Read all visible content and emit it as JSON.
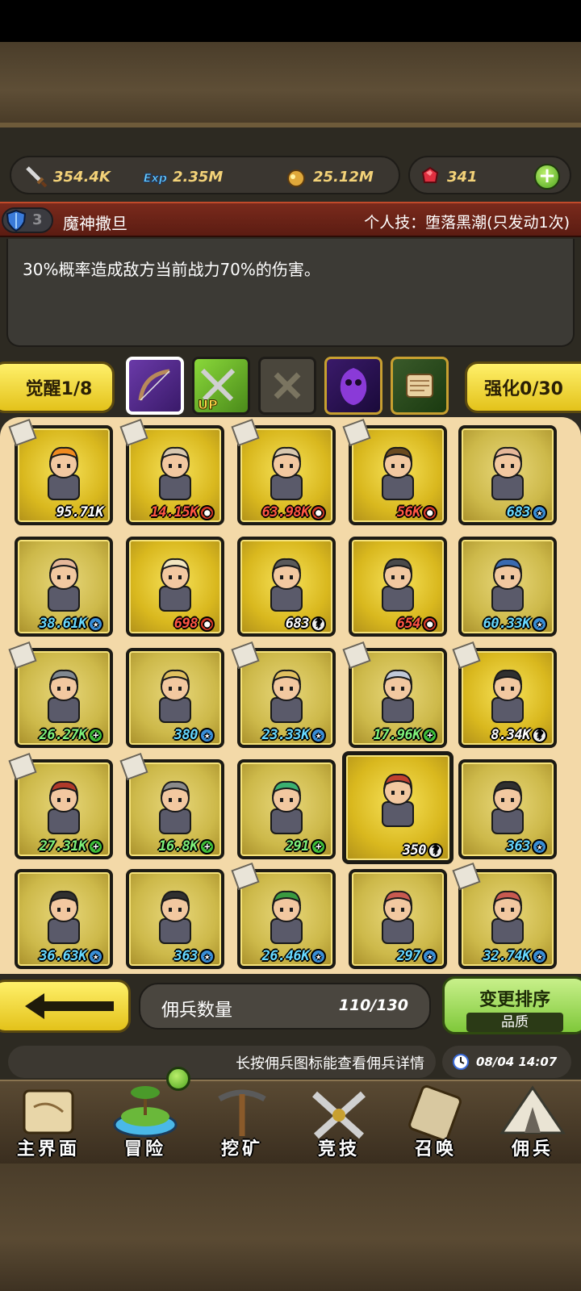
{
  "resources": {
    "attack": "354.4K",
    "exp": "2.35M",
    "gold": "25.12M",
    "gems": "341"
  },
  "skill": {
    "level": "3",
    "name": "魔神撒旦",
    "type": "个人技：堕落黑潮(只发动1次)",
    "description": "30%概率造成敌方当前战力70%的伤害。"
  },
  "tabs": {
    "awaken": "觉醒1/8",
    "enhance": "强化0/30",
    "icons": [
      "bow-icon",
      "upgrade-up-icon",
      "empty-slot-icon",
      "dark-spirit-icon",
      "scroll-icon"
    ],
    "up_label": "UP"
  },
  "mercenaries": [
    {
      "power": "95.71K",
      "color": "white",
      "badge": "",
      "note": true,
      "hair": "#f08a20"
    },
    {
      "power": "14.15K",
      "color": "red",
      "badge": "red",
      "note": true,
      "hair": "#d8c8b0"
    },
    {
      "power": "63.98K",
      "color": "red",
      "badge": "red",
      "note": true,
      "hair": "#d8c8b0"
    },
    {
      "power": "56K",
      "color": "red",
      "badge": "red",
      "note": true,
      "hair": "#6a4a20"
    },
    {
      "power": "683",
      "color": "blue",
      "badge": "blue",
      "note": false,
      "hair": "#e6b89a"
    },
    {
      "power": "38.61K",
      "color": "blue",
      "badge": "blue",
      "note": false,
      "hair": "#e6b89a"
    },
    {
      "power": "698",
      "color": "red",
      "badge": "red",
      "note": false,
      "hair": "#f2e6c0"
    },
    {
      "power": "683",
      "color": "white",
      "badge": "white",
      "note": false,
      "hair": "#5a5a5a"
    },
    {
      "power": "654",
      "color": "red",
      "badge": "red",
      "note": false,
      "hair": "#4a4a4a"
    },
    {
      "power": "60.33K",
      "color": "blue",
      "badge": "blue",
      "note": false,
      "hair": "#3a6ab0"
    },
    {
      "power": "26.27K",
      "color": "green",
      "badge": "green",
      "note": true,
      "hair": "#808890"
    },
    {
      "power": "380",
      "color": "blue",
      "badge": "blue",
      "note": false,
      "hair": "#e0c060"
    },
    {
      "power": "23.33K",
      "color": "blue",
      "badge": "blue",
      "note": true,
      "hair": "#e0c060"
    },
    {
      "power": "17.96K",
      "color": "green",
      "badge": "green",
      "note": true,
      "hair": "#c0c8d8"
    },
    {
      "power": "8.34K",
      "color": "white",
      "badge": "white",
      "note": true,
      "hair": "#303030"
    },
    {
      "power": "27.31K",
      "color": "green",
      "badge": "green",
      "note": true,
      "hair": "#b03a2a"
    },
    {
      "power": "16.8K",
      "color": "green",
      "badge": "green",
      "note": true,
      "hair": "#8a8a8a"
    },
    {
      "power": "291",
      "color": "green",
      "badge": "green",
      "note": false,
      "hair": "#3ab070"
    },
    {
      "power": "350",
      "color": "white",
      "badge": "white",
      "note": false,
      "hair": "#c04030",
      "big": true
    },
    {
      "power": "363",
      "color": "blue",
      "badge": "blue",
      "note": false,
      "hair": "#303030"
    },
    {
      "power": "36.63K",
      "color": "blue",
      "badge": "blue",
      "note": false,
      "hair": "#303030"
    },
    {
      "power": "363",
      "color": "blue",
      "badge": "blue",
      "note": false,
      "hair": "#303030"
    },
    {
      "power": "26.46K",
      "color": "blue",
      "badge": "blue",
      "note": true,
      "hair": "#3a9a40"
    },
    {
      "power": "297",
      "color": "blue",
      "badge": "blue",
      "note": false,
      "hair": "#c85a50"
    },
    {
      "power": "32.74K",
      "color": "blue",
      "badge": "blue",
      "note": true,
      "hair": "#c85a50"
    }
  ],
  "footer": {
    "count_label": "佣兵数量",
    "count_value": "110/130",
    "sort_title": "变更排序",
    "sort_sub": "品质",
    "hint": "长按佣兵图标能查看佣兵详情",
    "time": "08/04 14:07"
  },
  "nav": [
    {
      "label": "主界面",
      "icon": "map-scroll-icon"
    },
    {
      "label": "冒险",
      "icon": "island-icon"
    },
    {
      "label": "挖矿",
      "icon": "pickaxe-icon"
    },
    {
      "label": "竞技",
      "icon": "crossed-swords-icon"
    },
    {
      "label": "召唤",
      "icon": "summon-scroll-icon"
    },
    {
      "label": "佣兵",
      "icon": "tent-icon"
    }
  ]
}
